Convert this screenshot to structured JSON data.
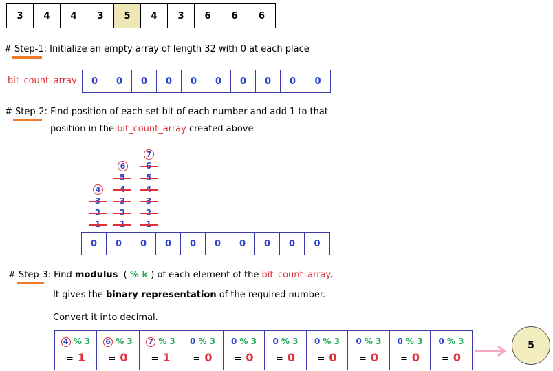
{
  "input_array": [
    "3",
    "4",
    "4",
    "3",
    "5",
    "4",
    "3",
    "6",
    "6",
    "6"
  ],
  "highlight_index": 4,
  "step1": {
    "hash": "#",
    "label": "Step-1",
    "text": ": Initialize  an  empty  array  of  length  32  with  0  at  each  place"
  },
  "bit_count_label": "bit_count_array",
  "zero_array": [
    "0",
    "0",
    "0",
    "0",
    "0",
    "0",
    "0",
    "0",
    "0",
    "0"
  ],
  "step2": {
    "hash": "#",
    "label": "Step-2",
    "line1": ":  Find position of each set bit of each number and add 1 to that",
    "line2_a": "position  in  the",
    "line2_link": "bit_count_array",
    "line2_b": "created  above"
  },
  "bit_columns": [
    {
      "circled": "4",
      "struck": [
        "3",
        "2",
        "1"
      ]
    },
    {
      "circled": "6",
      "struck": [
        "5",
        "4",
        "3",
        "2",
        "1"
      ]
    },
    {
      "circled": "7",
      "struck": [
        "6",
        "5",
        "4",
        "3",
        "2",
        "1"
      ]
    }
  ],
  "second_array": [
    "0",
    "0",
    "0",
    "0",
    "0",
    "0",
    "0",
    "0",
    "0",
    "0"
  ],
  "step3": {
    "hash": "#",
    "label": "Step-3",
    "a": ":  Find",
    "b": "modulus",
    "c": "(",
    "d": "% k",
    "e": ")  of  each  element  of  the",
    "f": "bit_count_array",
    "g": ".",
    "line2_a": "It  gives  the",
    "line2_b": "binary  representation",
    "line2_c": "of  the  required  number.",
    "line3": "Convert  it  into  decimal."
  },
  "mod_cells": [
    {
      "val": "4",
      "circled": true,
      "op": "% 3",
      "eq": "=",
      "res": "1"
    },
    {
      "val": "6",
      "circled": true,
      "op": "% 3",
      "eq": "=",
      "res": "0"
    },
    {
      "val": "7",
      "circled": true,
      "op": "% 3",
      "eq": "=",
      "res": "1"
    },
    {
      "val": "0",
      "circled": false,
      "op": "% 3",
      "eq": "=",
      "res": "0"
    },
    {
      "val": "0",
      "circled": false,
      "op": "% 3",
      "eq": "=",
      "res": "0"
    },
    {
      "val": "0",
      "circled": false,
      "op": "% 3",
      "eq": "=",
      "res": "0"
    },
    {
      "val": "0",
      "circled": false,
      "op": "% 3",
      "eq": "=",
      "res": "0"
    },
    {
      "val": "0",
      "circled": false,
      "op": "% 3",
      "eq": "=",
      "res": "0"
    },
    {
      "val": "0",
      "circled": false,
      "op": "% 3",
      "eq": "=",
      "res": "0"
    },
    {
      "val": "0",
      "circled": false,
      "op": "% 3",
      "eq": "=",
      "res": "0"
    }
  ],
  "result": "5",
  "colors": {
    "highlight": "#efe6b6",
    "red": "#e0303a",
    "blue": "#2f43c9",
    "green": "#22a85a",
    "underline": "#f07c2a",
    "arrow": "#f4a6c4"
  }
}
